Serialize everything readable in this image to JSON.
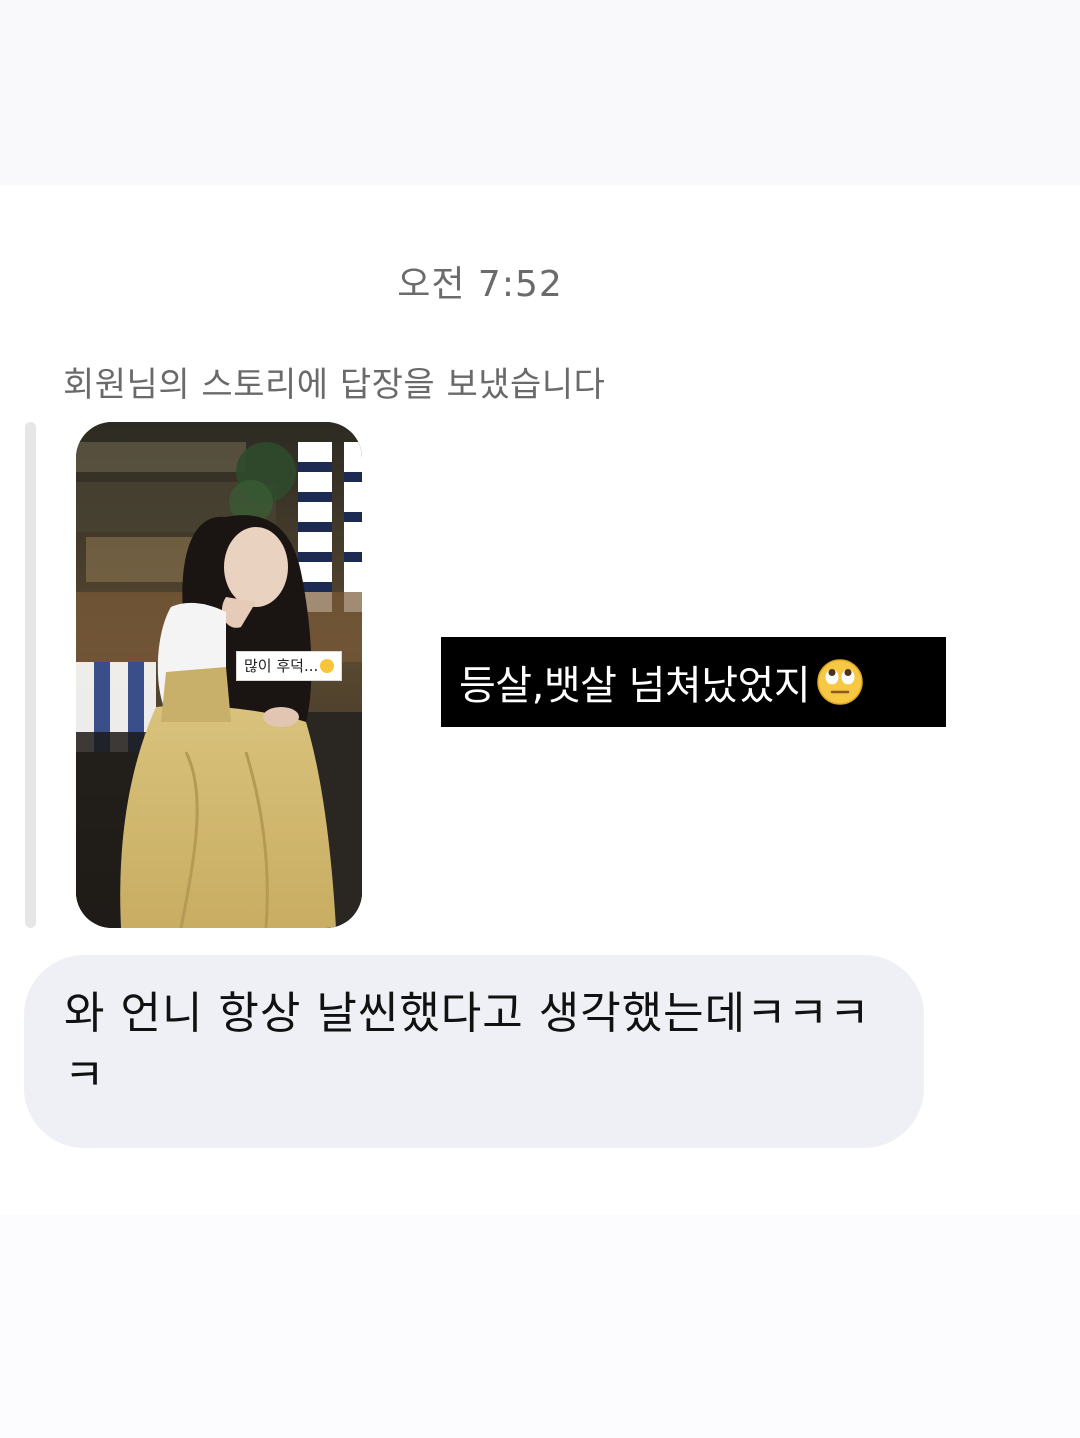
{
  "thread": {
    "timestamp": "오전 7:52",
    "reply_notice": "회원님의 스토리에 답장을 보냈습니다"
  },
  "story_reply": {
    "sticker_text": "많이 후덕...",
    "sticker_icon": "smirk-emoji-icon",
    "caption_text": "등살,뱃살 넘쳐났었지",
    "caption_icon": "roll-eyes-emoji-icon"
  },
  "message": {
    "text": "와 언니 항상 날씬했다고 생각했는데ㅋㅋㅋㅋ"
  },
  "colors": {
    "bubble_background": "#eff0f5",
    "caption_background": "#000000",
    "meta_text": "#6b6b6b"
  }
}
